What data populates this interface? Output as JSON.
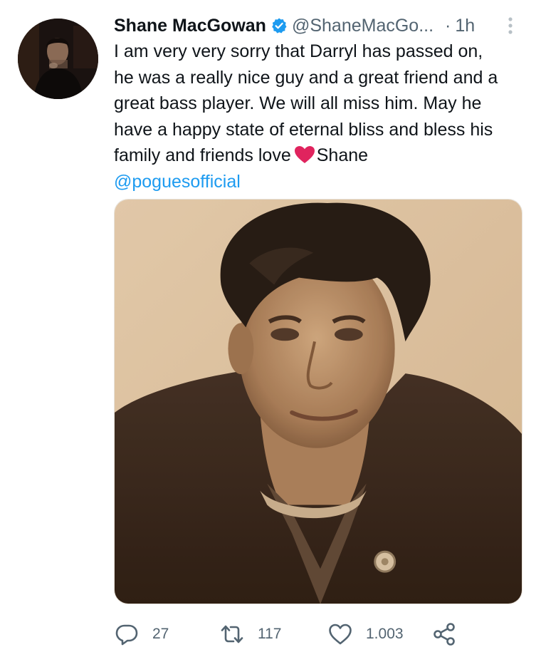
{
  "author": {
    "display_name": "Shane MacGowan",
    "handle": "@ShaneMacGo...",
    "separator": "·",
    "time": "1h",
    "verified": true
  },
  "tweet": {
    "lines": [
      "I am very very sorry that Darryl has passed on,",
      "he was a really nice guy and a great friend and a",
      "great bass player. We will all miss him. May he",
      "have a happy state of eternal bliss and bless his",
      "family and friends love"
    ],
    "signoff": "Shane",
    "mention": "@poguesofficial",
    "emoji": "red-heart"
  },
  "actions": {
    "reply_count": "27",
    "retweet_count": "117",
    "like_count": "1.003"
  },
  "icons": {
    "reply": "reply-icon",
    "retweet": "retweet-icon",
    "like": "heart-icon",
    "share": "share-icon",
    "more": "more-vertical-icon",
    "verified": "verified-badge-icon"
  },
  "colors": {
    "text": "#0f1419",
    "secondary": "#536471",
    "accent": "#1d9bf0",
    "heart_emoji": "#e0245e"
  }
}
